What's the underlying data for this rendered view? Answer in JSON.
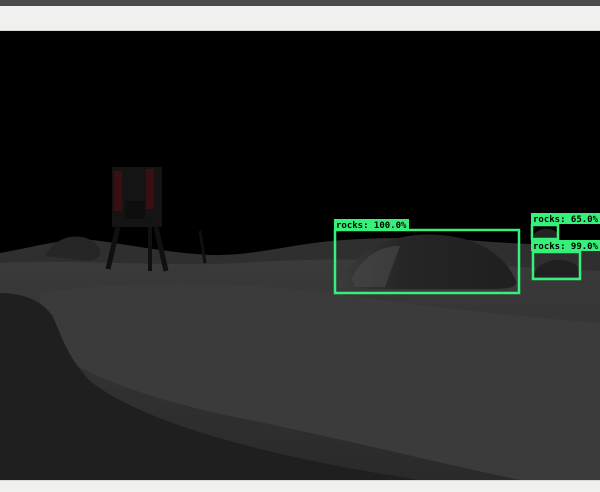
{
  "viewer": {
    "title": "",
    "colors": {
      "detection_box": "#37f07a",
      "background": "#000000",
      "chrome": "#f0f0ef"
    }
  },
  "detections": [
    {
      "label_text": "rocks: 100.0%",
      "class": "rocks",
      "confidence": 100.0
    },
    {
      "label_text": "rocks: 65.0%",
      "class": "rocks",
      "confidence": 65.0
    },
    {
      "label_text": "rocks: 99.0%",
      "class": "rocks",
      "confidence": 99.0
    }
  ]
}
